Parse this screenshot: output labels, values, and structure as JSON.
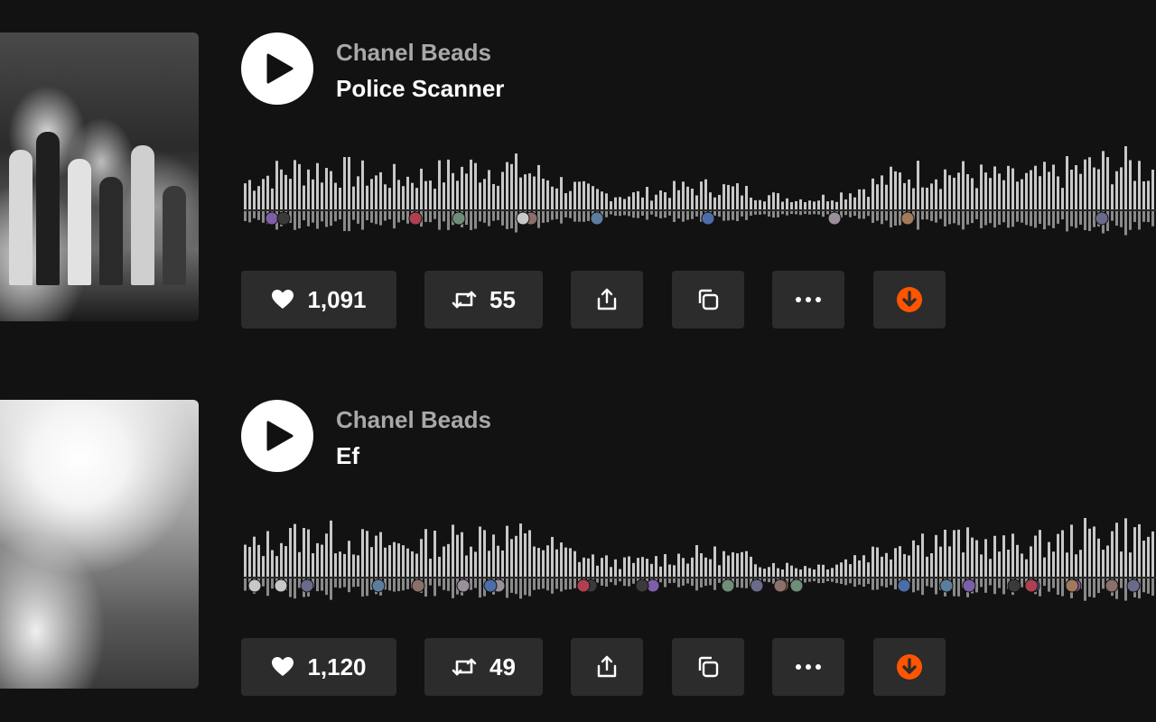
{
  "tracks": [
    {
      "artist": "Chanel Beads",
      "title": "Police Scanner",
      "likes": "1,091",
      "reposts": "55",
      "artwork_icon": "cover-artwork-image",
      "comment_avatar_count": 11
    },
    {
      "artist": "Chanel Beads",
      "title": "Ef",
      "likes": "1,120",
      "reposts": "49",
      "artwork_icon": "cover-artwork-image",
      "comment_avatar_count": 27
    }
  ],
  "icons": {
    "play": "play-icon",
    "like": "heart-icon",
    "repost": "repost-icon",
    "share": "share-icon",
    "copy": "copy-icon",
    "more": "more-icon",
    "download": "download-icon"
  },
  "colors": {
    "background": "#121212",
    "waveform_bar": "#c8c8c8",
    "button_bg": "#2c2c2c",
    "download_accent": "#ff5500",
    "artist_text": "#a8a8a8",
    "title_text": "#ffffff"
  }
}
